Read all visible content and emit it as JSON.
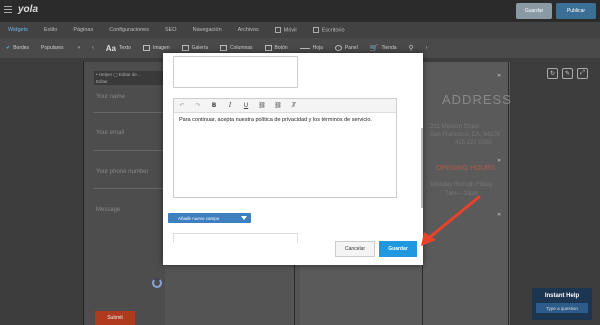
{
  "header": {
    "logo": "yola",
    "save_label": "Guardar",
    "publish_label": "Publicar"
  },
  "nav": {
    "tabs": [
      {
        "label": "Widgets",
        "active": true
      },
      {
        "label": "Estilo"
      },
      {
        "label": "Páginas"
      },
      {
        "label": "Configuraciones"
      },
      {
        "label": "SEO"
      },
      {
        "label": "Navegación"
      },
      {
        "label": "Archivos"
      },
      {
        "label": "Móvil"
      },
      {
        "label": "Escritorio"
      }
    ]
  },
  "toolbar": {
    "borders_label": "Bordes",
    "style_value": "Populares",
    "items": [
      "Texto",
      "Imagen",
      "Galería",
      "Columnas",
      "Botón",
      "Hoja",
      "Panel",
      "Tienda"
    ]
  },
  "canvas": {
    "widget_head": "• Helper  ▢ Editar de…",
    "widget_edit": "Editar",
    "form_labels": [
      "Your name",
      "Your email",
      "Your phone number",
      "Message"
    ],
    "submit_label": "Submit",
    "address_title": "ADDRESS",
    "address_lines": [
      "201 Mission Street",
      "San Francisco, CA, 94105",
      "415 227 0200"
    ],
    "hours_title": "OPENING HOURS",
    "hours_lines": [
      "Monday through Friday",
      "7am – 10pm"
    ]
  },
  "modal": {
    "editor_text": "Para continuar, acepta nuestra política de privacidad y los términos de servicio.",
    "add_field_label": "Añadir nuevo campo",
    "cancel_label": "Cancelar",
    "save_label": "Guardar"
  },
  "help": {
    "title": "Instant Help",
    "button_label": "Type a question"
  },
  "colors": {
    "accent": "#1f98e0",
    "arrow": "#e8432a",
    "brand": "#3b6f96"
  }
}
